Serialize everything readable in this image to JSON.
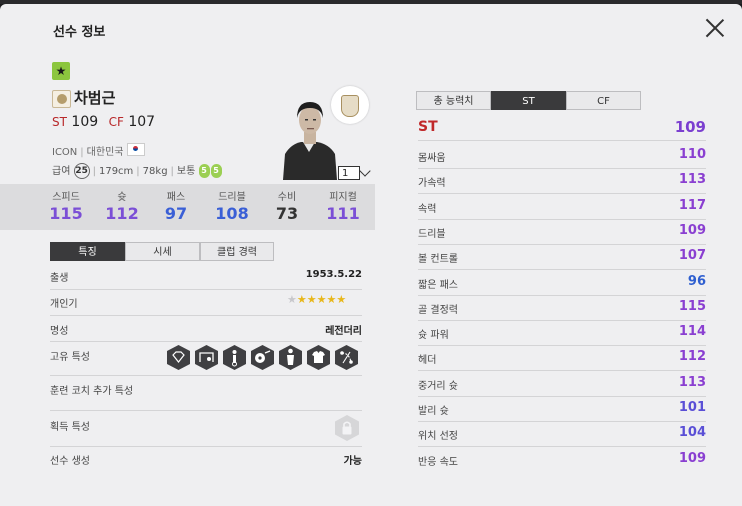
{
  "title": "선수 정보",
  "player": {
    "name": "차범근",
    "positions": [
      {
        "pos": "ST",
        "ovr": "109"
      },
      {
        "pos": "CF",
        "ovr": "107"
      }
    ],
    "season": "ICON",
    "nation": "대한민국",
    "salary_label": "급여",
    "salary": "25",
    "height": "179cm",
    "weight": "78kg",
    "body": "보통",
    "foot_left": "5",
    "foot_right": "5",
    "level": "1"
  },
  "stats": [
    {
      "label": "스피드",
      "value": "115",
      "color": "#7b4fd6"
    },
    {
      "label": "슛",
      "value": "112",
      "color": "#7b4fd6"
    },
    {
      "label": "패스",
      "value": "97",
      "color": "#3a5fd6"
    },
    {
      "label": "드리블",
      "value": "108",
      "color": "#3a5fd6"
    },
    {
      "label": "수비",
      "value": "73",
      "color": "#333333"
    },
    {
      "label": "피지컬",
      "value": "111",
      "color": "#7b4fd6"
    }
  ],
  "left_tabs": [
    "특징",
    "시세",
    "클럽 경력"
  ],
  "info": {
    "birth_label": "출생",
    "birth": "1953.5.22",
    "popularity_label": "개인기",
    "fame_label": "명성",
    "fame": "레전더리",
    "traits_label": "고유 특성",
    "coach_label": "훈련 코치 추가 특성",
    "acquired_label": "획득 특성",
    "create_label": "선수 생성",
    "create": "가능"
  },
  "right_tabs": [
    "총 능력치",
    "ST",
    "CF"
  ],
  "ability_header": {
    "label": "ST",
    "value": "109"
  },
  "abilities": [
    {
      "label": "몸싸움",
      "value": "110",
      "color": "#8a3fd1"
    },
    {
      "label": "가속력",
      "value": "113",
      "color": "#8a3fd1"
    },
    {
      "label": "속력",
      "value": "117",
      "color": "#8a3fd1"
    },
    {
      "label": "드리블",
      "value": "109",
      "color": "#8a3fd1"
    },
    {
      "label": "볼 컨트롤",
      "value": "107",
      "color": "#8a3fd1"
    },
    {
      "label": "짧은 패스",
      "value": "96",
      "color": "#2f5fd0"
    },
    {
      "label": "골 결정력",
      "value": "115",
      "color": "#8a3fd1"
    },
    {
      "label": "슛 파워",
      "value": "114",
      "color": "#8a3fd1"
    },
    {
      "label": "헤더",
      "value": "112",
      "color": "#8a3fd1"
    },
    {
      "label": "중거리 슛",
      "value": "113",
      "color": "#8a3fd1"
    },
    {
      "label": "발리 슛",
      "value": "101",
      "color": "#5a4fd6"
    },
    {
      "label": "위치 선정",
      "value": "104",
      "color": "#5a4fd6"
    },
    {
      "label": "반응 속도",
      "value": "109",
      "color": "#8a3fd1"
    }
  ],
  "colors": {
    "accent_red": "#b8282a",
    "header_red": "#c0282a",
    "ovr_purple": "#7b3fd0"
  },
  "popularity_stars": 5,
  "popularity_max": 6,
  "icons": [
    "close-icon",
    "star-icon",
    "icon-badge",
    "korea-flag-icon",
    "lock-icon"
  ]
}
